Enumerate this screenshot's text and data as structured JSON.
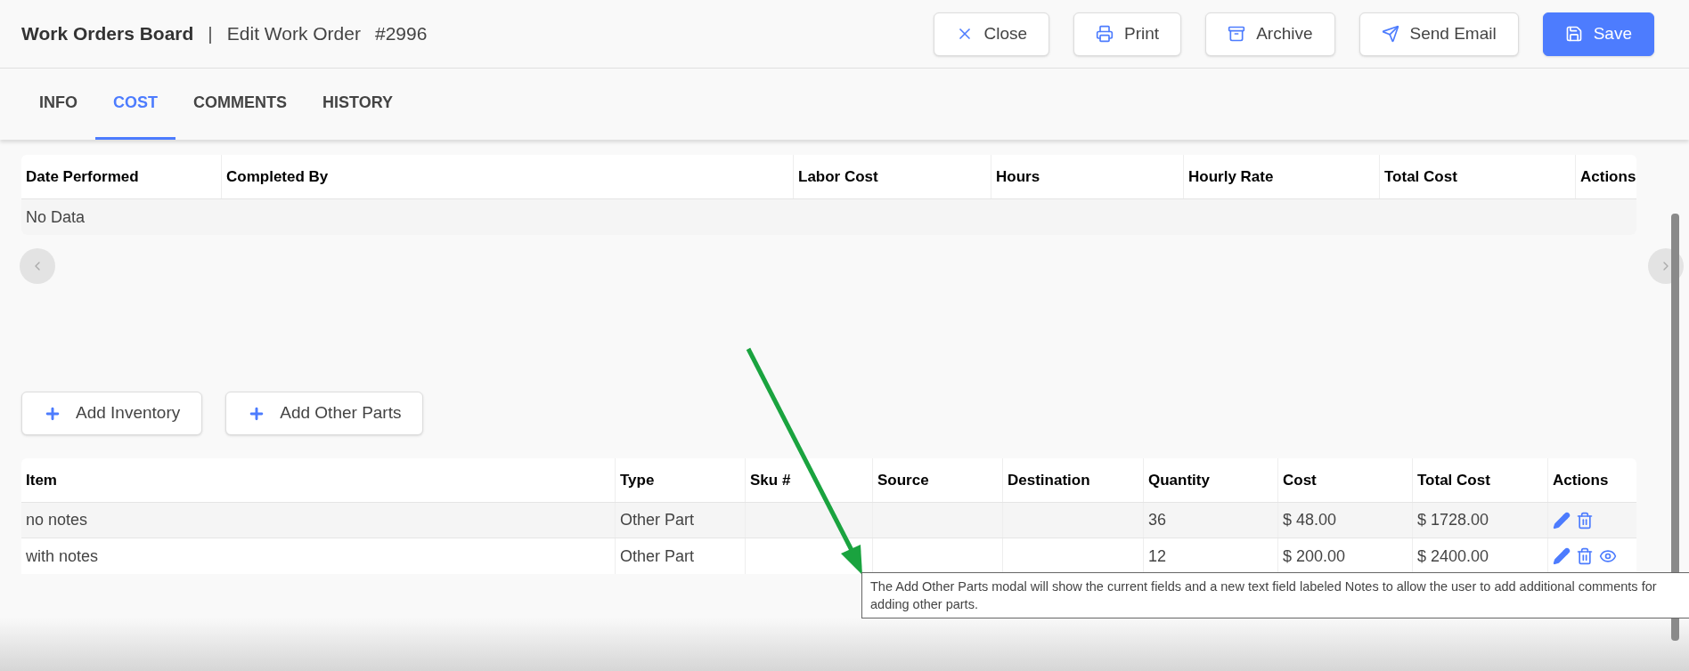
{
  "header": {
    "title": "Work Orders Board",
    "separator": "|",
    "subtitle": "Edit Work Order",
    "number": "#2996"
  },
  "actions": [
    {
      "kind": "close",
      "label": "Close"
    },
    {
      "kind": "print",
      "label": "Print"
    },
    {
      "kind": "archive",
      "label": "Archive"
    },
    {
      "kind": "email",
      "label": "Send Email"
    },
    {
      "kind": "save",
      "label": "Save"
    }
  ],
  "tabs": [
    {
      "label": "INFO",
      "selected": false
    },
    {
      "label": "COST",
      "selected": true
    },
    {
      "label": "COMMENTS",
      "selected": false
    },
    {
      "label": "HISTORY",
      "selected": false
    }
  ],
  "labor_table": {
    "columns": [
      "Date Performed",
      "Completed By",
      "Labor Cost",
      "Hours",
      "Hourly Rate",
      "Total Cost",
      "Actions"
    ],
    "empty_text": "No Data"
  },
  "add_buttons": [
    "Add Inventory",
    "Add Other Parts"
  ],
  "parts_table": {
    "columns": [
      "Item",
      "Type",
      "Sku #",
      "Source",
      "Destination",
      "Quantity",
      "Cost",
      "Total Cost",
      "Actions"
    ],
    "rows": [
      {
        "cells": [
          "no notes",
          "Other Part",
          "",
          "",
          "",
          "36",
          "$ 48.00",
          "$ 1728.00"
        ],
        "actions": [
          {
            "kind": "edit"
          },
          {
            "kind": "delete"
          }
        ]
      },
      {
        "cells": [
          "with notes",
          "Other Part",
          "",
          "",
          "",
          "12",
          "$ 200.00",
          "$ 2400.00"
        ],
        "actions": [
          {
            "kind": "edit"
          },
          {
            "kind": "delete"
          },
          {
            "kind": "view"
          }
        ]
      }
    ]
  },
  "annotation": {
    "note": "The Add Other Parts modal will show the current fields and a new text field labeled Notes to allow the user to add additional comments for adding other parts."
  }
}
